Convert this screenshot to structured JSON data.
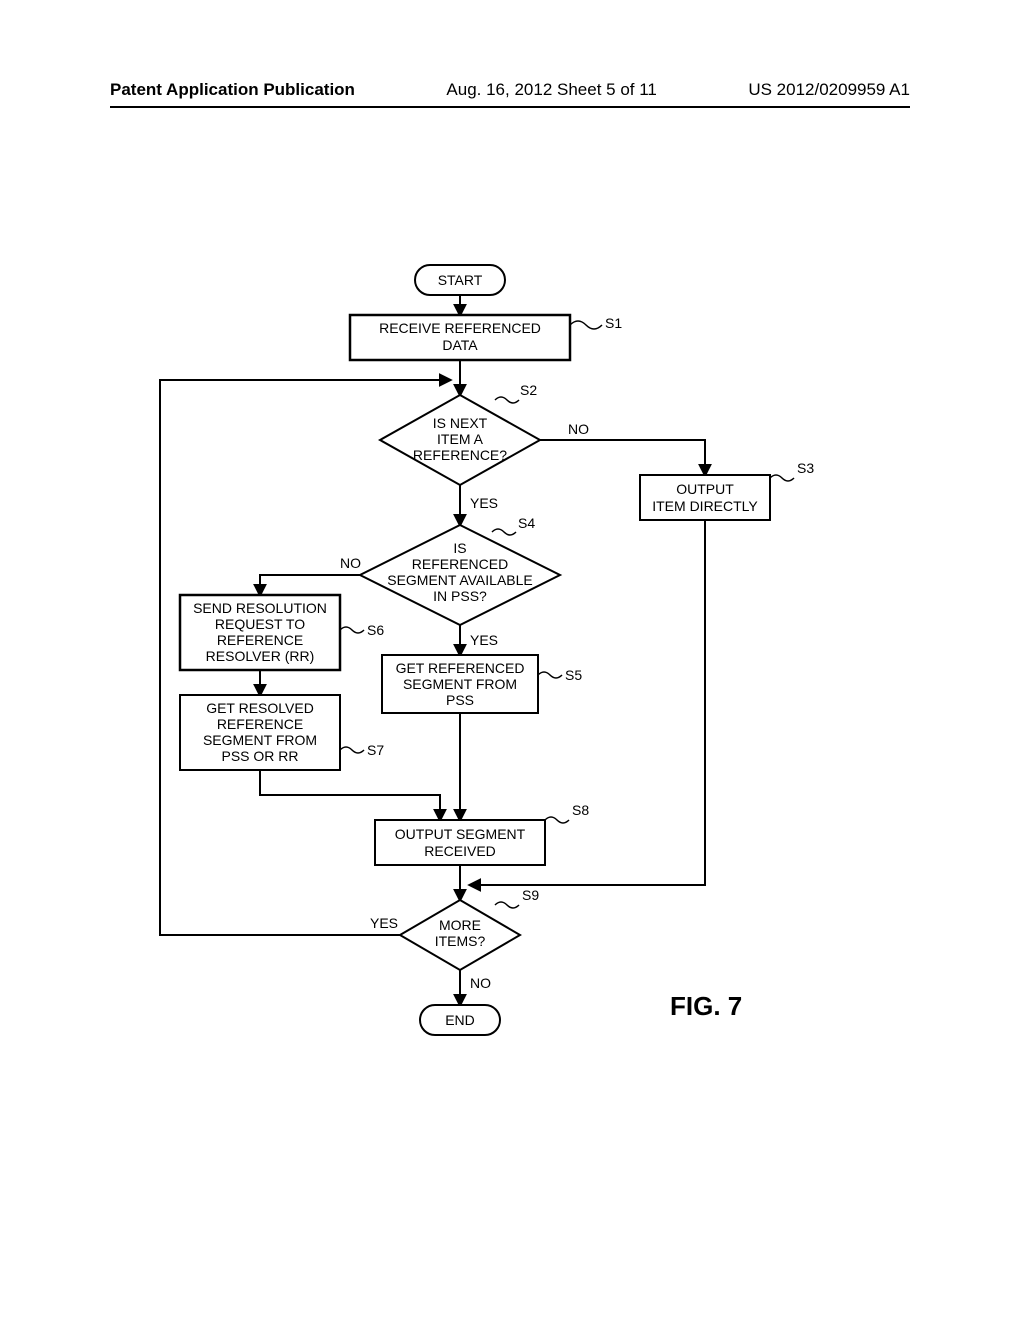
{
  "header": {
    "left": "Patent Application Publication",
    "mid": "Aug. 16, 2012  Sheet 5 of 11",
    "right": "US 2012/0209959 A1"
  },
  "figure_label": "FIG. 7",
  "nodes": {
    "start": "START",
    "end": "END",
    "s1": {
      "lines": [
        "RECEIVE REFERENCED",
        "DATA"
      ],
      "tag": "S1"
    },
    "s2": {
      "lines": [
        "IS NEXT",
        "ITEM A",
        "REFERENCE?"
      ],
      "tag": "S2"
    },
    "s3": {
      "lines": [
        "OUTPUT",
        "ITEM DIRECTLY"
      ],
      "tag": "S3"
    },
    "s4": {
      "lines": [
        "IS",
        "REFERENCED",
        "SEGMENT AVAILABLE",
        "IN PSS?"
      ],
      "tag": "S4"
    },
    "s5": {
      "lines": [
        "GET REFERENCED",
        "SEGMENT FROM",
        "PSS"
      ],
      "tag": "S5"
    },
    "s6": {
      "lines": [
        "SEND RESOLUTION",
        "REQUEST TO",
        "REFERENCE",
        "RESOLVER (RR)"
      ],
      "tag": "S6"
    },
    "s7": {
      "lines": [
        "GET RESOLVED",
        "REFERENCE",
        "SEGMENT FROM",
        "PSS OR RR"
      ],
      "tag": "S7"
    },
    "s8": {
      "lines": [
        "OUTPUT SEGMENT",
        "RECEIVED"
      ],
      "tag": "S8"
    },
    "s9": {
      "lines": [
        "MORE",
        "ITEMS?"
      ],
      "tag": "S9"
    }
  },
  "edges": {
    "yes": "YES",
    "no": "NO"
  }
}
